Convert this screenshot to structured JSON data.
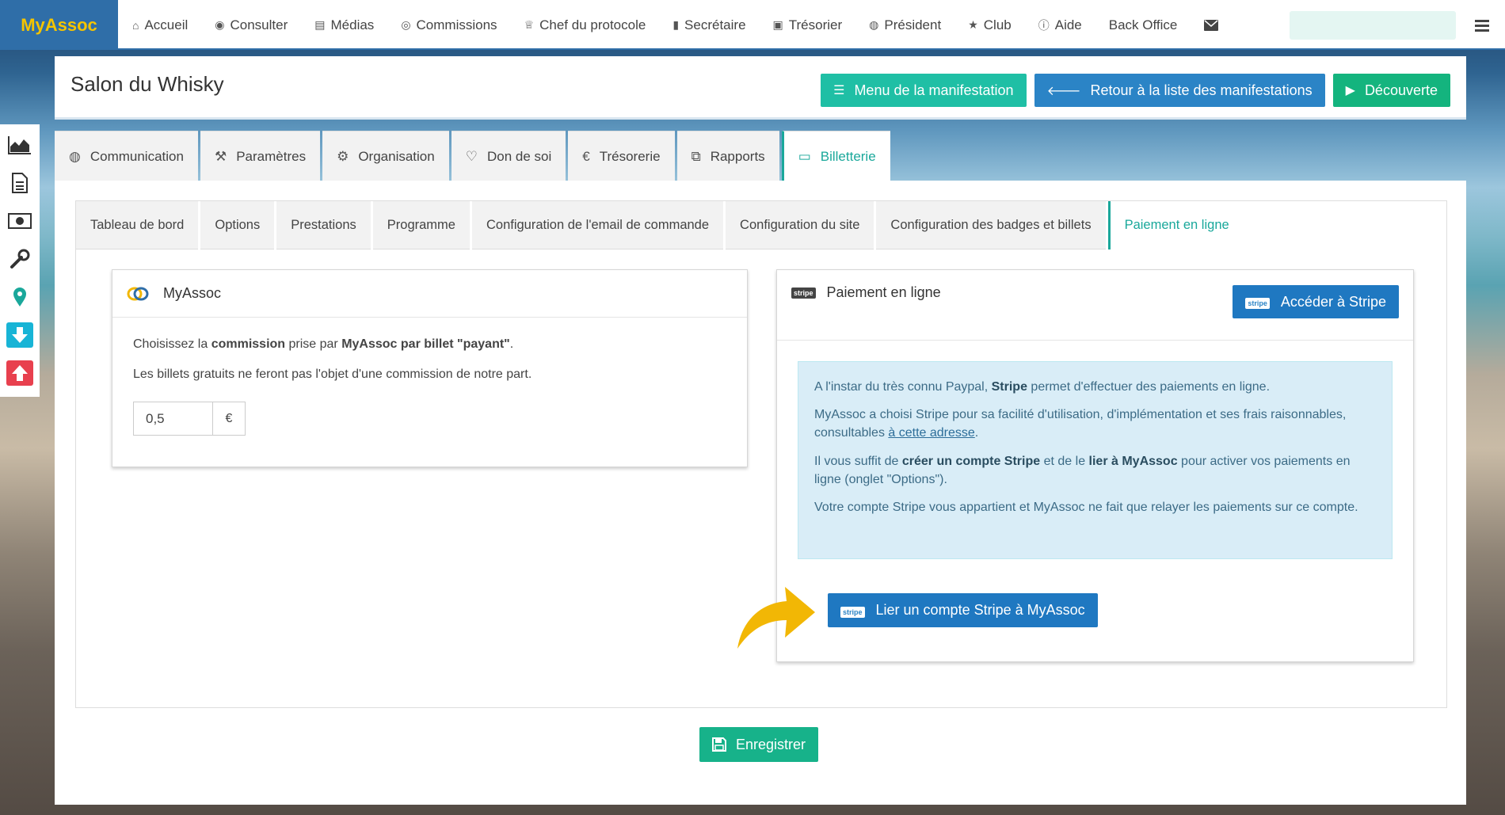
{
  "brand": "MyAssoc",
  "nav": [
    {
      "icon": "home-icon",
      "glyph": "⌂",
      "label": "Accueil"
    },
    {
      "icon": "eye-icon",
      "glyph": "◉",
      "label": "Consulter"
    },
    {
      "icon": "file-icon",
      "glyph": "▤",
      "label": "Médias"
    },
    {
      "icon": "user-circle-icon",
      "glyph": "◎",
      "label": "Commissions"
    },
    {
      "icon": "trophy-icon",
      "glyph": "♕",
      "label": "Chef du protocole"
    },
    {
      "icon": "book-icon",
      "glyph": "▮",
      "label": "Secrétaire"
    },
    {
      "icon": "money-icon",
      "glyph": "▣",
      "label": "Trésorier"
    },
    {
      "icon": "globe-icon",
      "glyph": "◍",
      "label": "Président"
    },
    {
      "icon": "star-icon",
      "glyph": "★",
      "label": "Club"
    },
    {
      "icon": "info-icon",
      "glyph": "ⓘ",
      "label": "Aide"
    },
    {
      "icon": "",
      "glyph": "",
      "label": "Back Office"
    }
  ],
  "header": {
    "title": "Salon du Whisky",
    "btn_menu": "Menu de la manifestation",
    "btn_back": "Retour à la liste des manifestations",
    "btn_discover": "Découverte"
  },
  "main_tabs": [
    {
      "icon": "globe-icon",
      "glyph": "◍",
      "label": "Communication"
    },
    {
      "icon": "wrench-icon",
      "glyph": "⚒",
      "label": "Paramètres"
    },
    {
      "icon": "cogs-icon",
      "glyph": "⚙",
      "label": "Organisation"
    },
    {
      "icon": "heart-icon",
      "glyph": "♡",
      "label": "Don de soi"
    },
    {
      "icon": "euro-icon",
      "glyph": "€",
      "label": "Trésorerie"
    },
    {
      "icon": "copy-icon",
      "glyph": "⧉",
      "label": "Rapports"
    },
    {
      "icon": "credit-card-icon",
      "glyph": "▭",
      "label": "Billetterie"
    }
  ],
  "sub_tabs": [
    "Tableau de bord",
    "Options",
    "Prestations",
    "Programme",
    "Configuration de l'email de commande",
    "Configuration du site",
    "Configuration des badges et billets",
    "Paiement en ligne"
  ],
  "commission": {
    "title": "MyAssoc",
    "line1_pre": "Choisissez la ",
    "line1_b1": "commission",
    "line1_mid": " prise par ",
    "line1_b2": "MyAssoc par billet \"payant\"",
    "line1_end": ".",
    "line2": "Les billets gratuits ne feront pas l'objet d'une commission de notre part.",
    "value": "0,5",
    "unit": "€"
  },
  "payment": {
    "stripe_badge": "stripe",
    "title": "Paiement en ligne",
    "btn_access": "Accéder à Stripe",
    "p1_pre": "A l'instar du très connu Paypal, ",
    "p1_b": "Stripe",
    "p1_post": " permet d'effectuer des paiements en ligne.",
    "p2_pre": "MyAssoc a choisi Stripe pour sa facilité d'utilisation, d'implémentation et ses frais raisonnables, consultables ",
    "p2_link": "à cette adresse",
    "p2_post": ".",
    "p3_pre": "Il vous suffit de ",
    "p3_b1": "créer un compte Stripe",
    "p3_mid": " et de le ",
    "p3_b2": "lier à MyAssoc",
    "p3_post": " pour activer vos paiements en ligne (onglet \"Options\").",
    "p4": "Votre compte Stripe vous appartient et MyAssoc ne fait que relayer les paiements sur ce compte.",
    "btn_link": "Lier un compte Stripe à MyAssoc"
  },
  "save_label": "Enregistrer",
  "colors": {
    "brand_blue": "#2f6ea8",
    "accent_teal": "#1aa89b",
    "stripe_blue": "#1f78c1",
    "arrow_yellow": "#f2b705"
  }
}
